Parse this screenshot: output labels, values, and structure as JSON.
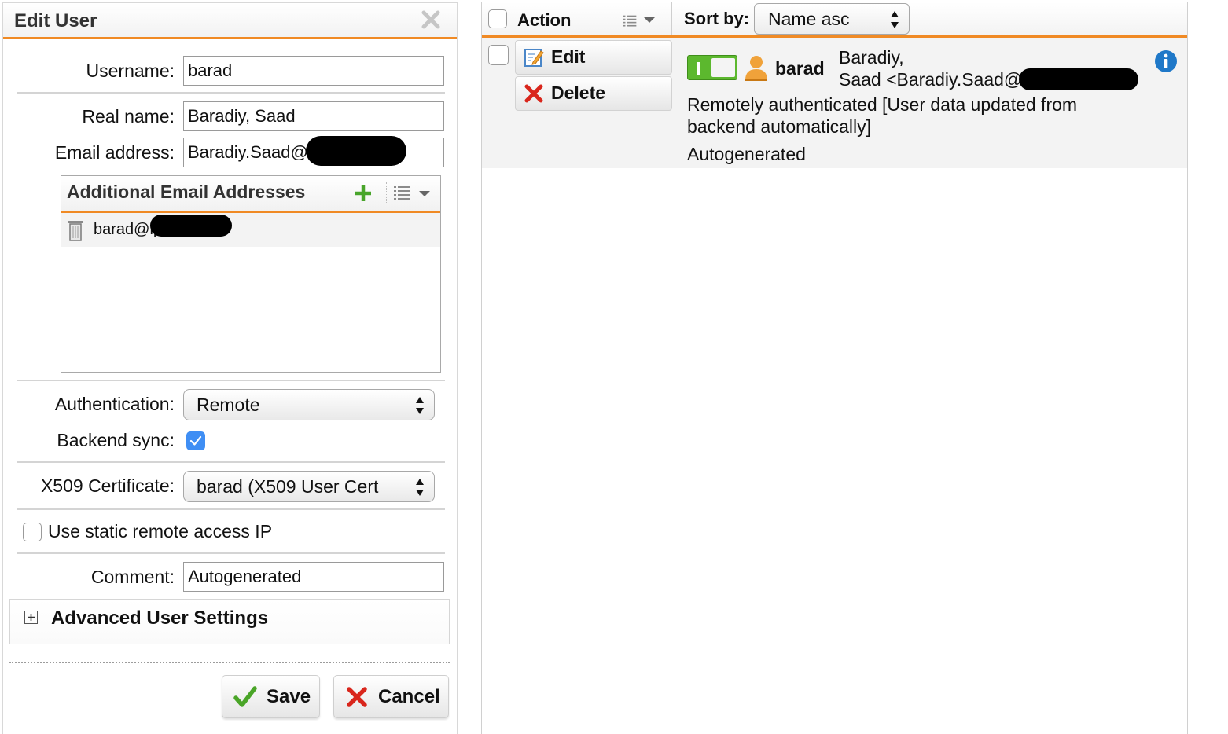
{
  "dialog": {
    "title": "Edit User",
    "username_label": "Username:",
    "username_value": "barad",
    "realname_label": "Real name:",
    "realname_value": "Baradiy, Saad",
    "email_label": "Email address:",
    "email_value": "Baradiy.Saad@",
    "additional_email": {
      "title": "Additional Email Addresses",
      "items": [
        "barad@ip"
      ]
    },
    "auth_label": "Authentication:",
    "auth_value": "Remote",
    "backend_sync_label": "Backend sync:",
    "backend_sync_checked": true,
    "x509_label": "X509 Certificate:",
    "x509_value": "barad (X509 User Cert",
    "static_ip_label": "Use static remote access IP",
    "static_ip_checked": false,
    "comment_label": "Comment:",
    "comment_value": "Autogenerated",
    "advanced_label": "Advanced User Settings",
    "save_label": "Save",
    "cancel_label": "Cancel"
  },
  "list": {
    "action_label": "Action",
    "sort_label": "Sort by:",
    "sort_value": "Name asc",
    "edit_label": "Edit",
    "delete_label": "Delete",
    "user": {
      "name": "barad",
      "realname_line1": "Baradiy,",
      "realname_line2": "Saad <Baradiy.Saad@",
      "description": "Remotely authenticated [User data updated from backend automatically]",
      "comment": "Autogenerated",
      "enabled": true
    }
  },
  "colors": {
    "accent": "#f08a24",
    "checkbox_on": "#3f8ef4",
    "toggle_on": "#5cb82e",
    "info": "#1f78c8"
  }
}
